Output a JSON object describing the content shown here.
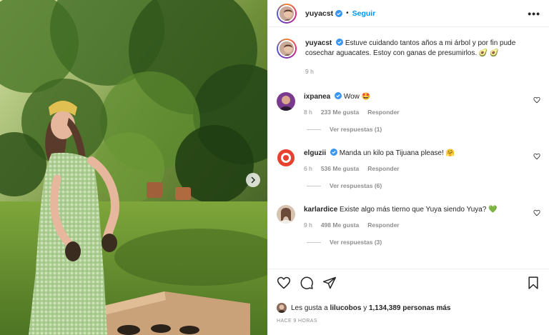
{
  "post": {
    "username": "yuyacst",
    "follow_label": "Seguir",
    "separator": "•",
    "more_label": "•••",
    "caption": "Estuve cuidando tantos años a mi árbol y por fin pude cosechar aguacates. Estoy con ganas de presumirlos. 🥑 🥑",
    "caption_time": "9 h"
  },
  "comments": [
    {
      "username": "ixpanea",
      "text": "Wow 🤩",
      "time": "8 h",
      "likes": "233 Me gusta",
      "reply_label": "Responder",
      "view_replies": "Ver respuestas (1)",
      "avatar_color": "#7a3b8f"
    },
    {
      "username": "elguzii",
      "text": "Manda un kilo pa Tijuana please! 🤗",
      "time": "6 h",
      "likes": "536 Me gusta",
      "reply_label": "Responder",
      "view_replies": "Ver respuestas (6)",
      "avatar_color": "#e8412f"
    },
    {
      "username": "karlardice",
      "text": "Existe algo más tierno que Yuya siendo Yuya? 💚",
      "time": "9 h",
      "likes": "498 Me gusta",
      "reply_label": "Responder",
      "view_replies": "Ver respuestas (3)",
      "avatar_color": "#d8c2b0"
    }
  ],
  "likes": {
    "prefix": "Les gusta a",
    "user": "lilucobos",
    "conjunction": "y",
    "count": "1,134,389 personas más"
  },
  "time_ago": "HACE 9 HORAS",
  "colors": {
    "accent": "#0095f6",
    "verified": "#3897f0",
    "muted": "#8e8e8e"
  },
  "icons": [
    "heart-icon",
    "comment-icon",
    "share-icon",
    "bookmark-icon",
    "verified-badge-icon",
    "chevron-right-icon",
    "more-options-icon"
  ]
}
